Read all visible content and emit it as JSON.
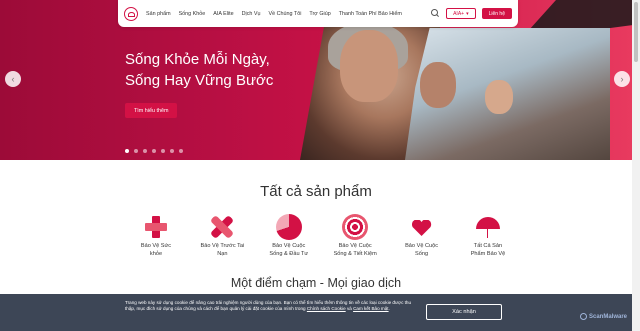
{
  "header": {
    "nav": [
      "Sản phẩm",
      "Sống Khỏe",
      "AIA Elite",
      "Dịch Vụ",
      "Về Chúng Tôi",
      "Trợ Giúp",
      "Thanh Toán Phí Bảo Hiểm"
    ],
    "aia_plus_label": "AIA+",
    "contact_label": "Liên hệ"
  },
  "hero": {
    "title_line1": "Sống Khỏe Mỗi Ngày,",
    "title_line2": "Sống Hay Vững Bước",
    "cta_label": "Tìm hiểu thêm",
    "slide_count": 7,
    "active_slide": 1
  },
  "products": {
    "title": "Tất cả sản phẩm",
    "items": [
      {
        "label": "Bảo Vệ Sức khỏe",
        "icon": "health-cross-icon"
      },
      {
        "label": "Bảo Vệ Trước Tai Nạn",
        "icon": "bandage-icon"
      },
      {
        "label": "Bảo Vệ Cuộc Sống & Đầu Tư",
        "icon": "pie-chart-icon"
      },
      {
        "label": "Bảo Vệ Cuộc Sống & Tiết Kiệm",
        "icon": "target-icon"
      },
      {
        "label": "Bảo Vệ Cuộc Sống",
        "icon": "heart-icon"
      },
      {
        "label": "Tất Cả Sản Phẩm Bảo Vệ",
        "icon": "umbrella-icon"
      }
    ]
  },
  "section2": {
    "title": "Một điểm chạm - Mọi giao dịch"
  },
  "cookie": {
    "text_main": "Trang web này sử dụng cookie để nâng cao trải nghiệm người dùng của bạn. Bạn có thể tìm hiểu thêm thông tin về các loại cookie được thu thập, mục đích sử dụng của chúng và cách để bạn quản lý cài đặt cookie của mình trong ",
    "link1": "Chính sách Cookie",
    "and": " và ",
    "link2": "Cam kết Bảo mật",
    "end": ".",
    "accept_label": "Xác nhận"
  },
  "watermark": "ScanMalware",
  "colors": {
    "brand": "#d31145",
    "cookie_bg": "#3d4656"
  }
}
